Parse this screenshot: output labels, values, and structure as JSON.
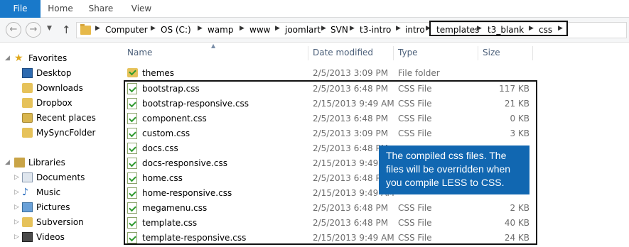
{
  "ribbon": {
    "tabs": [
      "File",
      "Home",
      "Share",
      "View"
    ]
  },
  "nav": {
    "back_icon": "back-arrow-icon",
    "forward_icon": "forward-arrow-icon",
    "up_icon": "up-arrow-icon",
    "breadcrumbs": [
      "Computer",
      "OS (C:)",
      "wamp",
      "www",
      "joomlart",
      "SVN",
      "t3-intro",
      "intro",
      "templates",
      "t3_blank",
      "css"
    ]
  },
  "sidebar": {
    "favorites": {
      "label": "Favorites",
      "items": [
        "Desktop",
        "Downloads",
        "Dropbox",
        "Recent places",
        "MySyncFolder"
      ]
    },
    "libraries": {
      "label": "Libraries",
      "items": [
        "Documents",
        "Music",
        "Pictures",
        "Subversion",
        "Videos"
      ]
    }
  },
  "columns": {
    "name": "Name",
    "date": "Date modified",
    "type": "Type",
    "size": "Size"
  },
  "files": [
    {
      "name": "themes",
      "date": "2/5/2013 3:09 PM",
      "type": "File folder",
      "size": ""
    },
    {
      "name": "bootstrap.css",
      "date": "2/5/2013 6:48 PM",
      "type": "CSS File",
      "size": "117 KB"
    },
    {
      "name": "bootstrap-responsive.css",
      "date": "2/15/2013 9:49 AM",
      "type": "CSS File",
      "size": "21 KB"
    },
    {
      "name": "component.css",
      "date": "2/5/2013 6:48 PM",
      "type": "CSS File",
      "size": "0 KB"
    },
    {
      "name": "custom.css",
      "date": "2/5/2013 3:09 PM",
      "type": "CSS File",
      "size": "3 KB"
    },
    {
      "name": "docs.css",
      "date": "2/5/2013 6:48 PM",
      "type": "",
      "size": ""
    },
    {
      "name": "docs-responsive.css",
      "date": "2/15/2013 9:49 AM",
      "type": "",
      "size": ""
    },
    {
      "name": "home.css",
      "date": "2/5/2013 6:48 PM",
      "type": "",
      "size": ""
    },
    {
      "name": "home-responsive.css",
      "date": "2/15/2013 9:49 AM",
      "type": "",
      "size": ""
    },
    {
      "name": "megamenu.css",
      "date": "2/5/2013 6:48 PM",
      "type": "CSS File",
      "size": "2 KB"
    },
    {
      "name": "template.css",
      "date": "2/5/2013 6:48 PM",
      "type": "CSS File",
      "size": "40 KB"
    },
    {
      "name": "template-responsive.css",
      "date": "2/15/2013 9:49 AM",
      "type": "CSS File",
      "size": "24 KB"
    }
  ],
  "callout": {
    "lines": [
      "The compiled css files. The",
      "files will be overridden when",
      "you compile LESS to CSS."
    ],
    "color": "#1167b1"
  },
  "colors": {
    "file_tab": "#1979ca",
    "header_text": "#4c607a"
  }
}
